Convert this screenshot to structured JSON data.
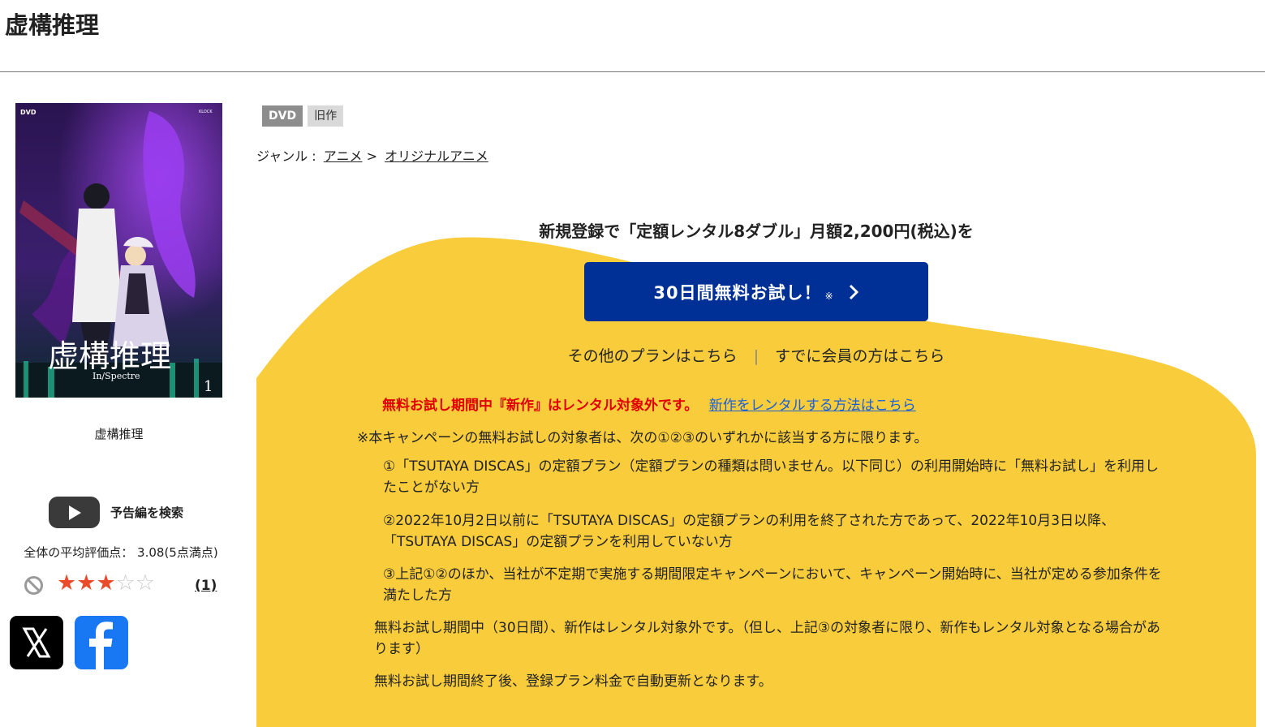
{
  "page": {
    "title": "虚構推理"
  },
  "product": {
    "name": "虚構推理",
    "badges": [
      "DVD",
      "旧作"
    ],
    "genre_label": "ジャンル :",
    "genre_path": [
      "アニメ",
      "オリジナルアニメ"
    ],
    "genre_separator": ">",
    "cover": {
      "title_text": "虚構推理",
      "subtitle_text": "In/Spectre",
      "volume": "1",
      "dvd_mark": "DVD",
      "publisher_mark": "KLOCK"
    },
    "trailer_label": "予告編を検索",
    "rating_summary": "全体の平均評価点： 3.08(5点満点)",
    "rating_value": 3.08,
    "rating_stars_filled": 3,
    "rating_stars_total": 5,
    "review_count_label": "(1)"
  },
  "share": {
    "x_icon": "x-logo-icon",
    "facebook_icon": "facebook-logo-icon"
  },
  "promo": {
    "headline": "新規登録で「定額レンタル8ダブル」月額2,200円(税込)を",
    "cta_label": "30日間無料お試し！",
    "cta_mark": "※",
    "other_plans_link": "その他のプランはこちら",
    "link_separator": "|",
    "member_link": "すでに会員の方はこちら",
    "warning_red": "無料お試し期間中『新作』はレンタル対象外です。",
    "warning_link": "新作をレンタルする方法はこちら",
    "notes_intro": "※本キャンペーンの無料お試しの対象者は、次の①②③のいずれかに該当する方に限ります。",
    "conditions": [
      "①「TSUTAYA DISCAS」の定額プラン（定額プランの種類は問いません。以下同じ）の利用開始時に「無料お試し」を利用したことがない方",
      "②2022年10月2日以前に「TSUTAYA DISCAS」の定額プランの利用を終了された方であって、2022年10月3日以降、「TSUTAYA DISCAS」の定額プランを利用していない方",
      "③上記①②のほか、当社が不定期で実施する期間限定キャンペーンにおいて、キャンペーン開始時に、当社が定める参加条件を満たした方"
    ],
    "note_trial": "無料お試し期間中（30日間）、新作はレンタル対象外です。（但し、上記③の対象者に限り、新作もレンタル対象となる場合があります）",
    "note_renewal": "無料お試し期間終了後、登録プラン料金で自動更新となります。"
  },
  "colors": {
    "promo_yellow": "#f8cc3a",
    "cta_blue": "#002f95",
    "warning_red": "#e00000",
    "link_blue": "#1a5fd6",
    "star_on": "#e94b2b"
  }
}
